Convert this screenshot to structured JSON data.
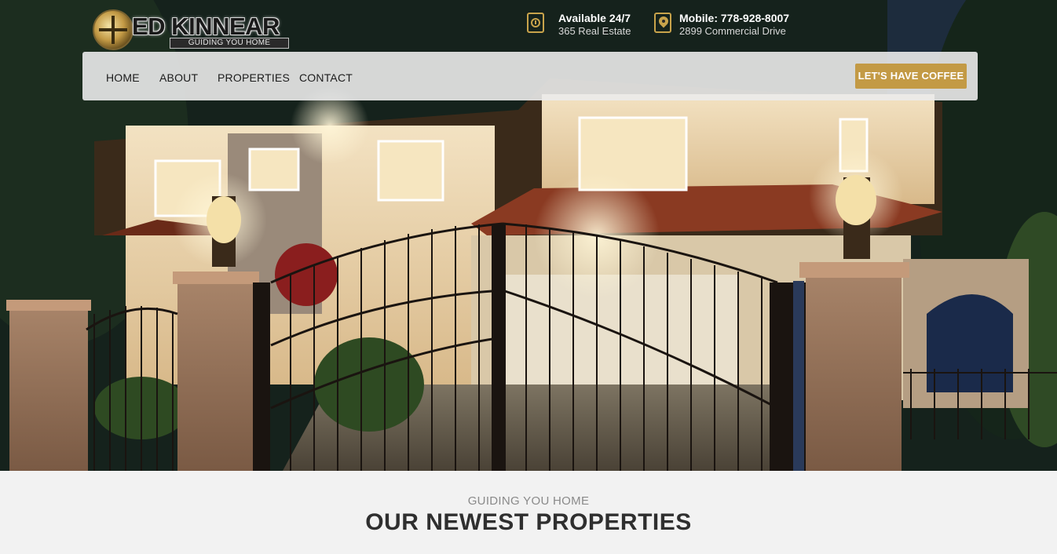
{
  "brand": {
    "name": "ED KINNEAR",
    "tagline": "GUIDING YOU HOME"
  },
  "contact": {
    "availability": {
      "title": "Available 24/7",
      "subtitle": "365 Real Estate",
      "icon": "clock-icon"
    },
    "location": {
      "title": "Mobile: 778-928-8007",
      "subtitle": "2899 Commercial Drive",
      "icon": "map-pin-icon"
    }
  },
  "nav": {
    "items": [
      {
        "label": "HOME"
      },
      {
        "label": "ABOUT"
      },
      {
        "label": "PROPERTIES"
      },
      {
        "label": "CONTACT"
      }
    ],
    "cta_label": "LET'S HAVE COFFEE"
  },
  "section": {
    "eyebrow": "GUIDING YOU HOME",
    "title": "OUR NEWEST PROPERTIES"
  },
  "colors": {
    "accent": "#c39a45",
    "nav_bg": "#ebebeb",
    "section_bg": "#f2f2f2",
    "title_text": "#2f2f2f"
  }
}
